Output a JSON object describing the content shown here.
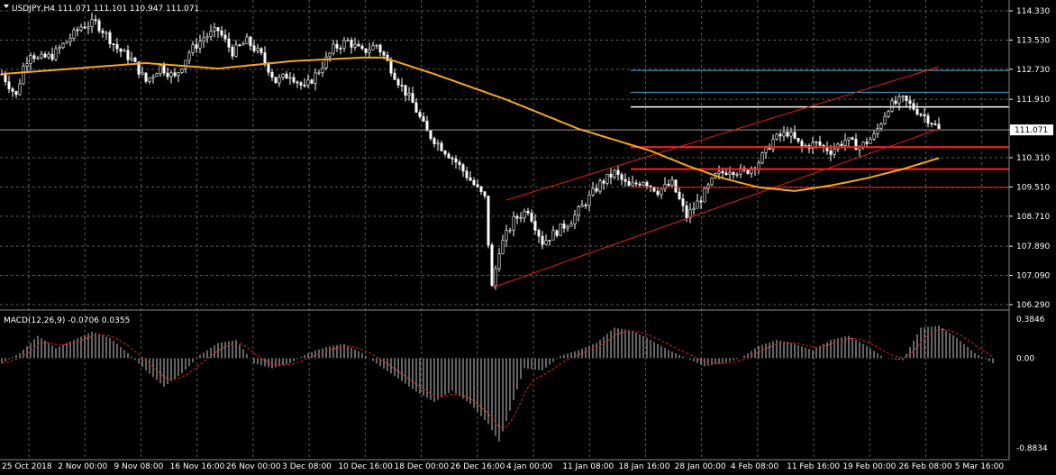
{
  "header": {
    "symbol_label": "USDJPY,H4  111.071 111.101 110.947 111.071",
    "indicator_label": "MACD(12,26,9) -0.0706 0.0355"
  },
  "price_axis": {
    "ticks": [
      "114.330",
      "113.530",
      "112.730",
      "111.910",
      "111.071",
      "110.310",
      "109.510",
      "108.710",
      "107.890",
      "107.090",
      "106.290"
    ],
    "current_price": "111.071"
  },
  "macd_axis": {
    "ticks": [
      "0.3846",
      "0.00",
      "-0.8834"
    ]
  },
  "time_axis": {
    "labels": [
      "25 Oct 2018",
      "2 Nov 00:00",
      "9 Nov 08:00",
      "16 Nov 16:00",
      "26 Nov 00:00",
      "3 Dec 08:00",
      "10 Dec 16:00",
      "18 Dec 00:00",
      "26 Dec 16:00",
      "4 Jan 00:00",
      "11 Jan 08:00",
      "18 Jan 16:00",
      "28 Jan 00:00",
      "4 Feb 08:00",
      "11 Feb 16:00",
      "19 Feb 00:00",
      "26 Feb 08:00",
      "5 Mar 16:00"
    ]
  },
  "colors": {
    "background": "#000000",
    "grid": "#5a5a5a",
    "axis_text": "#ffffff",
    "candle_up": "#000000",
    "candle_outline": "#ffffff",
    "ma_line": "#f5a623",
    "macd_hist": "#c8c8c8",
    "macd_signal": "#e02020",
    "channel": "#e02020",
    "support_lines": "#ff2020",
    "upper_levels": "#4aa6c8",
    "white_level": "#ffffff",
    "current_price_line": "#9a9a9a"
  },
  "chart_data": [
    {
      "type": "candlestick",
      "title": "USDJPY,H4",
      "ylim": [
        106.29,
        114.33
      ],
      "x_categories": [
        "25 Oct 2018",
        "2 Nov",
        "9 Nov",
        "16 Nov",
        "26 Nov",
        "3 Dec",
        "10 Dec",
        "18 Dec",
        "26 Dec",
        "4 Jan",
        "11 Jan",
        "18 Jan",
        "28 Jan",
        "4 Feb",
        "11 Feb",
        "19 Feb",
        "26 Feb",
        "5 Mar"
      ],
      "close_path": [
        [
          0,
          112.6
        ],
        [
          2,
          112.3
        ],
        [
          4,
          112.0
        ],
        [
          6,
          112.8
        ],
        [
          8,
          113.2
        ],
        [
          10,
          113.0
        ],
        [
          14,
          113.1
        ],
        [
          18,
          113.5
        ],
        [
          22,
          113.9
        ],
        [
          26,
          114.0
        ],
        [
          28,
          113.8
        ],
        [
          32,
          113.3
        ],
        [
          36,
          113.0
        ],
        [
          40,
          112.4
        ],
        [
          44,
          112.8
        ],
        [
          48,
          112.5
        ],
        [
          52,
          113.2
        ],
        [
          56,
          113.6
        ],
        [
          60,
          113.8
        ],
        [
          64,
          113.2
        ],
        [
          68,
          113.5
        ],
        [
          72,
          113.1
        ],
        [
          76,
          112.4
        ],
        [
          80,
          112.6
        ],
        [
          84,
          112.2
        ],
        [
          88,
          112.7
        ],
        [
          92,
          113.3
        ],
        [
          96,
          113.5
        ],
        [
          100,
          113.2
        ],
        [
          104,
          113.4
        ],
        [
          106,
          113.1
        ],
        [
          110,
          112.4
        ],
        [
          114,
          111.8
        ],
        [
          118,
          111.0
        ],
        [
          122,
          110.6
        ],
        [
          126,
          110.2
        ],
        [
          130,
          109.7
        ],
        [
          134,
          109.2
        ],
        [
          136,
          106.75
        ],
        [
          138,
          107.8
        ],
        [
          142,
          108.6
        ],
        [
          146,
          108.9
        ],
        [
          150,
          108.0
        ],
        [
          154,
          108.3
        ],
        [
          158,
          108.6
        ],
        [
          162,
          109.1
        ],
        [
          166,
          109.6
        ],
        [
          170,
          109.9
        ],
        [
          174,
          109.5
        ],
        [
          178,
          109.7
        ],
        [
          182,
          109.4
        ],
        [
          186,
          109.6
        ],
        [
          190,
          108.7
        ],
        [
          194,
          109.2
        ],
        [
          198,
          109.8
        ],
        [
          202,
          110.0
        ],
        [
          206,
          109.9
        ],
        [
          210,
          110.2
        ],
        [
          214,
          110.8
        ],
        [
          218,
          111.0
        ],
        [
          222,
          110.6
        ],
        [
          226,
          110.7
        ],
        [
          230,
          110.5
        ],
        [
          234,
          110.8
        ],
        [
          238,
          110.6
        ],
        [
          242,
          110.9
        ],
        [
          246,
          111.7
        ],
        [
          250,
          111.9
        ],
        [
          254,
          111.6
        ],
        [
          258,
          111.3
        ],
        [
          260,
          111.071
        ]
      ],
      "moving_average": [
        [
          0,
          112.6
        ],
        [
          20,
          112.75
        ],
        [
          40,
          112.9
        ],
        [
          60,
          112.75
        ],
        [
          80,
          112.95
        ],
        [
          100,
          113.05
        ],
        [
          106,
          113.05
        ],
        [
          120,
          112.6
        ],
        [
          140,
          111.9
        ],
        [
          160,
          111.1
        ],
        [
          180,
          110.5
        ],
        [
          190,
          110.1
        ],
        [
          200,
          109.75
        ],
        [
          210,
          109.5
        ],
        [
          220,
          109.4
        ],
        [
          230,
          109.55
        ],
        [
          240,
          109.75
        ],
        [
          250,
          110.0
        ],
        [
          260,
          110.3
        ]
      ],
      "channel": {
        "lower": [
          [
            136,
            106.75
          ],
          [
            260,
            111.1
          ]
        ],
        "upper": [
          [
            140,
            109.15
          ],
          [
            260,
            112.8
          ]
        ]
      },
      "horizontal_levels": {
        "upper_levels": [
          112.7,
          112.1
        ],
        "white_level": 111.7,
        "current_price": 111.071,
        "support_levels": [
          110.6,
          110.0,
          109.5
        ]
      }
    },
    {
      "type": "bar",
      "title": "MACD(12,26,9)",
      "ylim": [
        -0.8834,
        0.3846
      ],
      "value": -0.0706,
      "signal": 0.0355,
      "histogram_path": [
        [
          0,
          -0.05
        ],
        [
          5,
          0.05
        ],
        [
          10,
          0.22
        ],
        [
          15,
          0.1
        ],
        [
          20,
          0.18
        ],
        [
          25,
          0.26
        ],
        [
          30,
          0.2
        ],
        [
          35,
          0.05
        ],
        [
          40,
          -0.12
        ],
        [
          45,
          -0.28
        ],
        [
          50,
          -0.15
        ],
        [
          55,
          0.03
        ],
        [
          60,
          0.15
        ],
        [
          65,
          0.18
        ],
        [
          70,
          -0.05
        ],
        [
          75,
          -0.1
        ],
        [
          80,
          -0.05
        ],
        [
          85,
          0.05
        ],
        [
          90,
          0.11
        ],
        [
          95,
          0.14
        ],
        [
          100,
          0.05
        ],
        [
          105,
          -0.08
        ],
        [
          110,
          -0.2
        ],
        [
          115,
          -0.33
        ],
        [
          120,
          -0.43
        ],
        [
          125,
          -0.32
        ],
        [
          130,
          -0.45
        ],
        [
          135,
          -0.65
        ],
        [
          138,
          -0.82
        ],
        [
          140,
          -0.62
        ],
        [
          145,
          -0.1
        ],
        [
          150,
          -0.12
        ],
        [
          155,
          0.02
        ],
        [
          160,
          0.08
        ],
        [
          165,
          0.15
        ],
        [
          170,
          0.3
        ],
        [
          175,
          0.27
        ],
        [
          180,
          0.18
        ],
        [
          185,
          0.08
        ],
        [
          190,
          0.0
        ],
        [
          195,
          -0.08
        ],
        [
          200,
          -0.05
        ],
        [
          205,
          0.0
        ],
        [
          210,
          0.12
        ],
        [
          215,
          0.18
        ],
        [
          220,
          0.14
        ],
        [
          225,
          0.08
        ],
        [
          230,
          0.18
        ],
        [
          235,
          0.22
        ],
        [
          240,
          0.12
        ],
        [
          245,
          0.0
        ],
        [
          250,
          -0.02
        ],
        [
          255,
          0.3
        ],
        [
          260,
          0.32
        ],
        [
          265,
          0.2
        ],
        [
          270,
          0.05
        ],
        [
          275,
          -0.05
        ]
      ]
    }
  ]
}
